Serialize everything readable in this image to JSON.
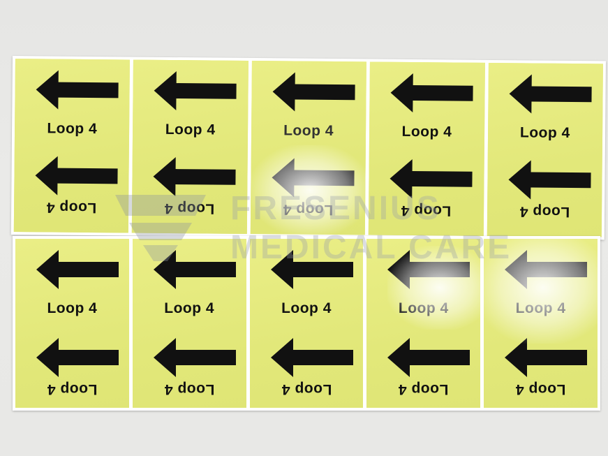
{
  "sheets": {
    "top": {
      "labels": [
        {
          "caption": "Loop 4",
          "caption_flipped": "Loop 4"
        },
        {
          "caption": "Loop 4",
          "caption_flipped": "Loop 4"
        },
        {
          "caption": "Loop 4",
          "caption_flipped": "Loop 4"
        },
        {
          "caption": "Loop 4",
          "caption_flipped": "Loop 4"
        },
        {
          "caption": "Loop 4",
          "caption_flipped": "Loop 4"
        }
      ]
    },
    "bottom": {
      "labels": [
        {
          "caption": "Loop 4",
          "caption_flipped": "Loop 4"
        },
        {
          "caption": "Loop 4",
          "caption_flipped": "Loop 4"
        },
        {
          "caption": "Loop 4",
          "caption_flipped": "Loop 4"
        },
        {
          "caption": "Loop 4",
          "caption_flipped": "Loop 4"
        },
        {
          "caption": "Loop 4",
          "caption_flipped": "Loop 4"
        }
      ]
    }
  },
  "watermark": {
    "line1": "FRESENIUS",
    "line2": "MEDICAL CARE"
  },
  "colors": {
    "label_yellow": "#e5ea7a",
    "arrow_black": "#111111",
    "sheet_white": "#ffffff",
    "background": "#e8e8e6"
  },
  "icons": {
    "arrow": "left-arrow-icon"
  }
}
